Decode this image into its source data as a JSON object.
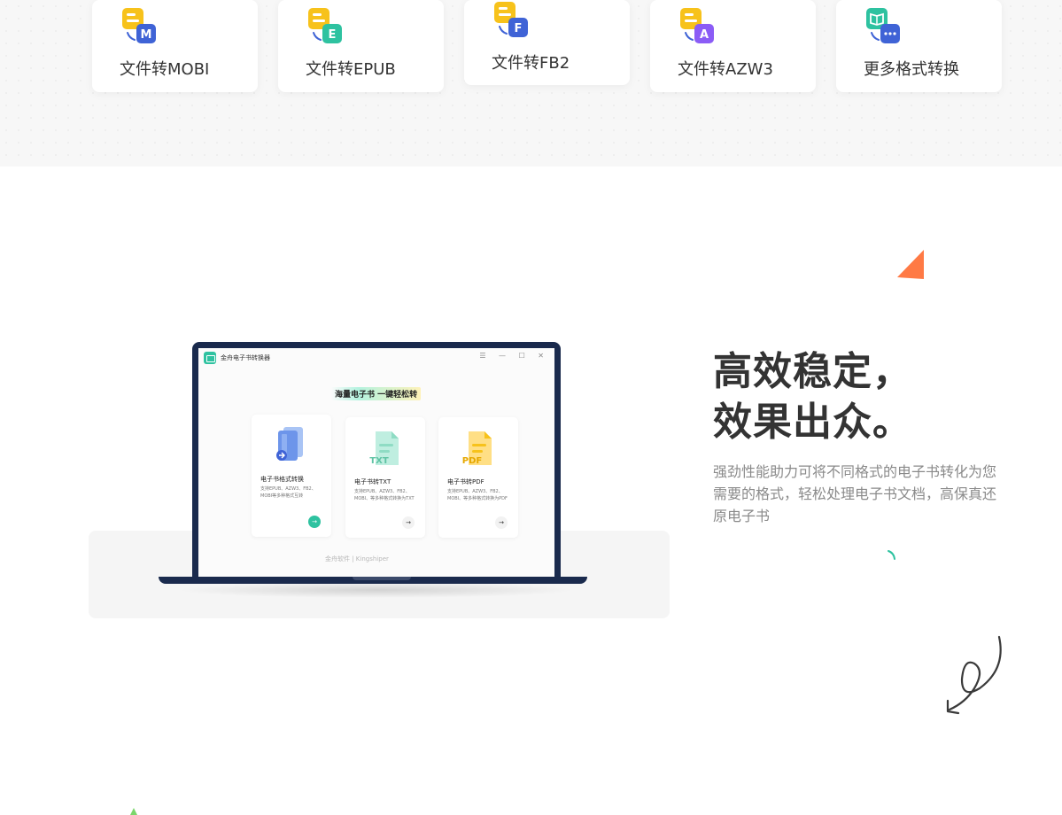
{
  "format_cards": [
    {
      "label": "文件转MOBI",
      "icon": "mobi-file-icon",
      "badge": "M",
      "badge_color": "#3f63d6"
    },
    {
      "label": "文件转EPUB",
      "icon": "epub-file-icon",
      "badge": "E",
      "badge_color": "#2ec2a0"
    },
    {
      "label": "文件转FB2",
      "icon": "fb2-file-icon",
      "badge": "F",
      "badge_color": "#3f63d6"
    },
    {
      "label": "文件转AZW3",
      "icon": "azw3-file-icon",
      "badge": "A",
      "badge_color": "#8b5cf6"
    },
    {
      "label": "更多格式转换",
      "icon": "more-formats-icon",
      "badge": "…",
      "badge_color": "#3f63d6"
    }
  ],
  "app_window": {
    "title": "金舟电子书转换器",
    "controls": "☰ — ☐ ✕",
    "headline": "海量电子书 一键轻松转",
    "cards": [
      {
        "title": "电子书格式转换",
        "desc": "支持EPUB、AZW3、FB2、MOBI等多种格式互转",
        "button": "→"
      },
      {
        "title": "电子书转TXT",
        "desc": "支持EPUB、AZW3、FB2、MOBI、等多种格式转换为TXT",
        "button": "→"
      },
      {
        "title": "电子书转PDF",
        "desc": "支持EPUB、AZW3、FB2、MOBI、等多种格式转换为PDF",
        "button": "→"
      }
    ],
    "footer": "金舟软件 | Kingshiper"
  },
  "feature": {
    "headline_line1": "高效稳定，",
    "headline_line2": "效果出众。",
    "description": "强劲性能助力可将不同格式的电子书转化为您需要的格式，轻松处理电子书文档，高保真还原电子书"
  },
  "colors": {
    "accent_teal": "#2ec2a0",
    "accent_orange": "#ff7a45",
    "laptop_navy": "#1a2a4d",
    "icon_yellow": "#f7c21b"
  }
}
